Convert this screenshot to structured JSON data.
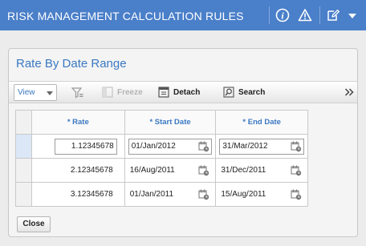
{
  "header": {
    "title": "RISK MANAGEMENT CALCULATION RULES",
    "icons": [
      "info-icon",
      "warning-icon",
      "edit-icon",
      "dropdown-caret-icon"
    ]
  },
  "panel": {
    "title": "Rate By Date Range",
    "toolbar": {
      "view_label": "View",
      "freeze_label": "Freeze",
      "detach_label": "Detach",
      "search_label": "Search",
      "more_icon": "double-chevron-right-icon"
    },
    "grid": {
      "columns": [
        "* Rate",
        "* Start Date",
        "* End Date"
      ],
      "rows": [
        {
          "rate": "1.12345678",
          "start_date": "01/Jan/2012",
          "end_date": "31/Mar/2012"
        },
        {
          "rate": "2.12345678",
          "start_date": "16/Aug/2011",
          "end_date": "31/Dec/2011"
        },
        {
          "rate": "3.12345678",
          "start_date": "01/Jan/2011",
          "end_date": "15/Aug/2011"
        }
      ]
    },
    "close_label": "Close"
  },
  "colors": {
    "header_bg": "#4a7fc9",
    "accent": "#3a78c2"
  }
}
